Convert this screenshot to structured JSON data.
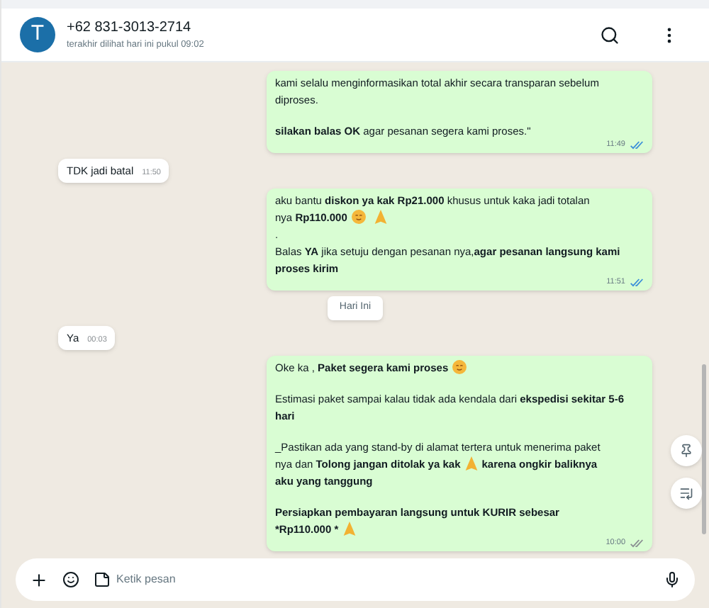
{
  "contact": {
    "initial": "T",
    "name": "+62 831-3013-2714",
    "last_seen": "terakhir dilihat hari ini pukul 09:02"
  },
  "messages": [
    {
      "kind": "outgoing",
      "paragraphs": [
        [
          {
            "kind": "text",
            "text": "kami selalu menginformasikan total akhir secara transparan sebelum diproses."
          }
        ],
        [
          {
            "kind": "text",
            "text": "**silakan balas OK** agar pesanan segera kami proses.\""
          }
        ]
      ],
      "time": "11:49",
      "read": true
    },
    {
      "kind": "incoming",
      "text": "TDK jadi batal",
      "time": "11:50"
    },
    {
      "kind": "outgoing",
      "paragraphs": [
        [
          {
            "kind": "text",
            "text": "aku bantu **diskon ya kak Rp21.000** khusus untuk kaka jadi totalan"
          },
          {
            "kind": "break"
          },
          {
            "kind": "text",
            "text": "nya **Rp110.000**"
          },
          {
            "kind": "smiley"
          },
          {
            "kind": "hands"
          },
          {
            "kind": "break"
          },
          {
            "kind": "text",
            "text": "."
          },
          {
            "kind": "break"
          },
          {
            "kind": "text",
            "text": "Balas **YA** jika setuju dengan pesanan nya,**agar pesanan langsung kami proses kirim**"
          }
        ]
      ],
      "time": "11:51",
      "read": true
    },
    {
      "kind": "date",
      "text": "Hari Ini"
    },
    {
      "kind": "incoming",
      "text": "Ya",
      "time": "00:03"
    },
    {
      "kind": "outgoing",
      "paragraphs": [
        [
          {
            "kind": "text",
            "text": "Oke ka , **Paket segera kami proses**"
          },
          {
            "kind": "smiley"
          }
        ],
        [
          {
            "kind": "text",
            "text": "Estimasi paket sampai kalau tidak ada kendala dari **ekspedisi sekitar 5-6 hari**"
          }
        ],
        [
          {
            "kind": "text",
            "text": "_Pastikan ada yang stand-by di alamat tertera untuk menerima paket"
          },
          {
            "kind": "break"
          },
          {
            "kind": "text",
            "text": "nya dan **Tolong jangan ditolak ya kak**"
          },
          {
            "kind": "hands"
          },
          {
            "kind": "text",
            "text": "**karena ongkir baliknya**"
          },
          {
            "kind": "break"
          },
          {
            "kind": "text",
            "text": "**aku yang tanggung**"
          }
        ],
        [
          {
            "kind": "text",
            "text": "**Persiapkan pembayaran langsung untuk KURIR sebesar**"
          },
          {
            "kind": "break"
          },
          {
            "kind": "text",
            "text": "***Rp110.000 ***"
          },
          {
            "kind": "hands"
          }
        ]
      ],
      "time": "10:00",
      "read": false
    }
  ],
  "composer": {
    "placeholder": "Ketik pesan"
  }
}
